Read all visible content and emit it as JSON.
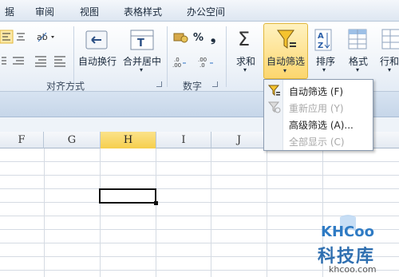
{
  "tabs": [
    "据",
    "审阅",
    "视图",
    "表格样式",
    "办公空间"
  ],
  "ribbon": {
    "wrap_text": "自动换行",
    "merge_center": "合并居中",
    "merge_arrow": "▾",
    "align_group": "对齐方式",
    "number_group": "数字",
    "percent": "%",
    "comma": "❟",
    "sum": "求和",
    "sigma": "Σ",
    "autofilter": "自动筛选",
    "sort": "排序",
    "format": "格式",
    "rows_cols": "行和"
  },
  "menu": {
    "items": [
      {
        "label": "自动筛选 (F)",
        "enabled": true
      },
      {
        "label": "重新应用 (Y)",
        "enabled": false
      },
      {
        "label": "高级筛选 (A)...",
        "enabled": true
      },
      {
        "label": "全部显示 (C)",
        "enabled": false
      }
    ]
  },
  "grid": {
    "columns": [
      "F",
      "G",
      "H",
      "I",
      "J"
    ],
    "selected_column": "H"
  },
  "watermark": {
    "logo": "KHCoo",
    "text": "科技库",
    "url": "khcoo.com"
  },
  "colors": {
    "accent": "#f6cf4d",
    "funnel": "#f0c419"
  }
}
